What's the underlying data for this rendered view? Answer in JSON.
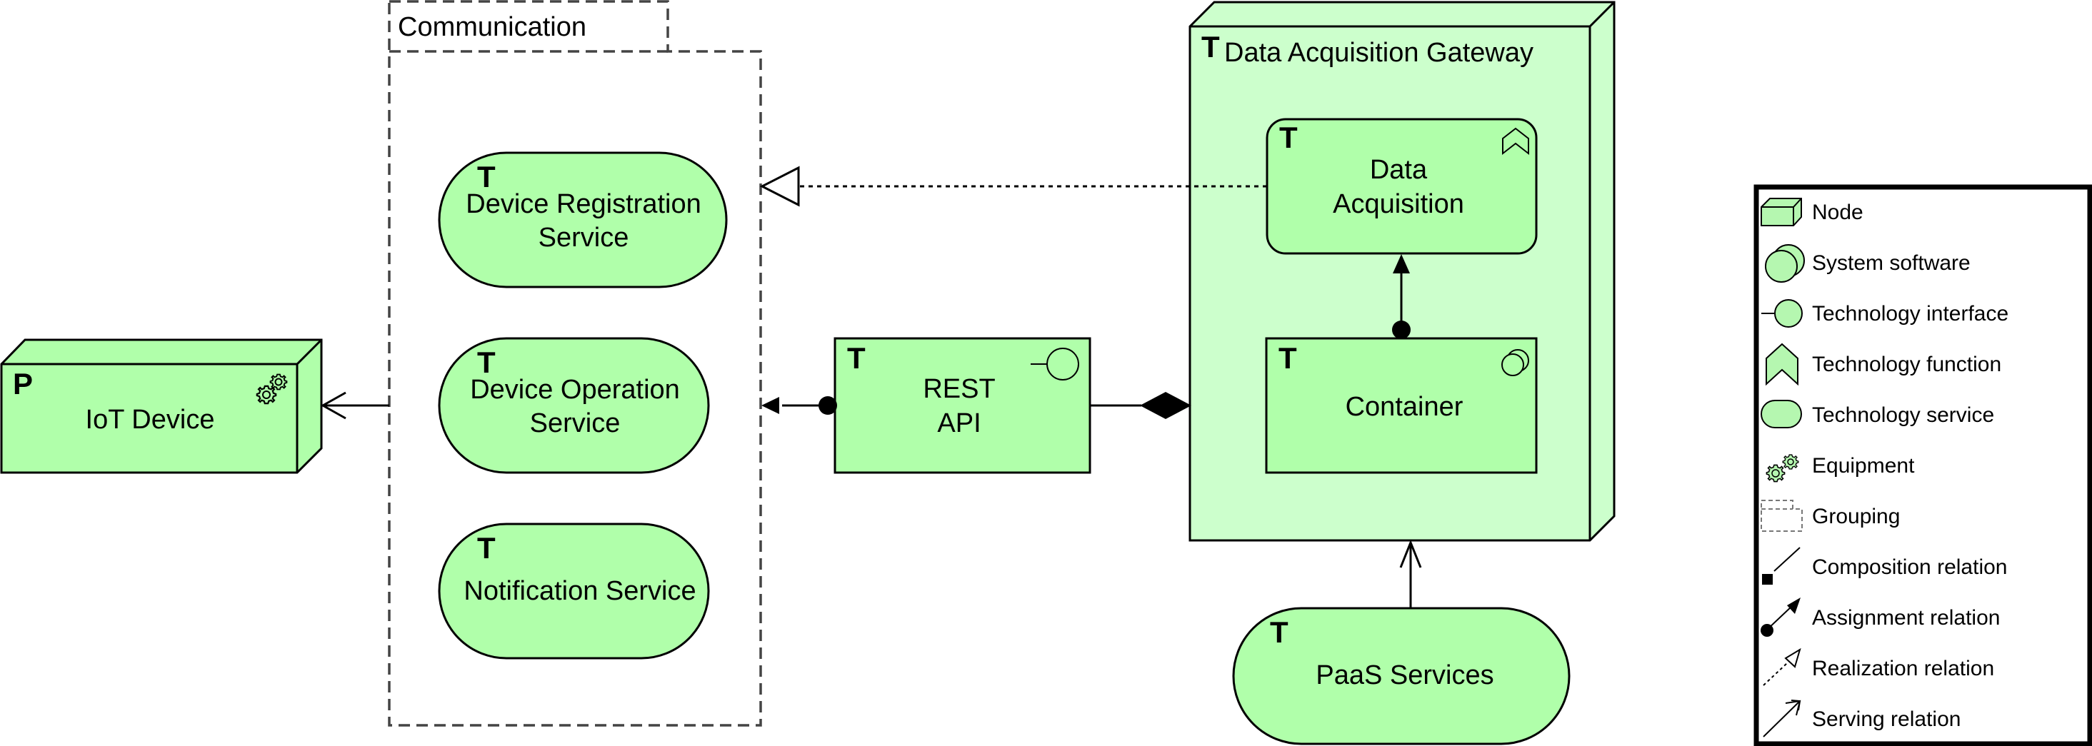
{
  "colors": {
    "element_fill": "#B0FFAA",
    "node_light_fill": "#CCFFCC",
    "stroke": "#000000",
    "grouping_stroke": "#444444",
    "legend_icon_fill": "#B5F7B0"
  },
  "grouping": {
    "label": "Communication"
  },
  "elements": {
    "iot_device": {
      "marker": "P",
      "label": "IoT Device",
      "icon": "equipment-gears-icon"
    },
    "device_registration": {
      "marker": "T",
      "label_line1": "Device Registration",
      "label_line2": "Service"
    },
    "device_operation": {
      "marker": "T",
      "label_line1": "Device Operation",
      "label_line2": "Service"
    },
    "notification": {
      "marker": "T",
      "label": "Notification Service"
    },
    "rest_api": {
      "marker": "T",
      "label_line1": "REST",
      "label_line2": "API",
      "icon": "technology-interface-icon"
    },
    "gateway": {
      "marker": "T",
      "label": "Data Acquisition Gateway"
    },
    "data_acquisition": {
      "marker": "T",
      "label_line1": "Data",
      "label_line2": "Acquisition",
      "icon": "technology-function-icon"
    },
    "container": {
      "marker": "T",
      "label": "Container",
      "icon": "system-software-icon"
    },
    "paas": {
      "marker": "T",
      "label": "PaaS Services"
    }
  },
  "relations": [
    {
      "type": "serving",
      "from": "Communication",
      "to": "IoT Device"
    },
    {
      "type": "realization",
      "from": "Data Acquisition",
      "to": "Communication"
    },
    {
      "type": "assignment",
      "from": "REST API",
      "to": "Device Operation Service"
    },
    {
      "type": "composition",
      "from": "Data Acquisition Gateway",
      "to": "REST API"
    },
    {
      "type": "assignment",
      "from": "Container",
      "to": "Data Acquisition"
    },
    {
      "type": "serving",
      "from": "PaaS Services",
      "to": "Data Acquisition Gateway"
    }
  ],
  "legend": {
    "items": [
      {
        "icon": "node-icon",
        "label": "Node"
      },
      {
        "icon": "system-software-icon",
        "label": "System software"
      },
      {
        "icon": "technology-interface-icon",
        "label": "Technology interface"
      },
      {
        "icon": "technology-function-icon",
        "label": "Technology function"
      },
      {
        "icon": "technology-service-icon",
        "label": "Technology service"
      },
      {
        "icon": "equipment-icon",
        "label": "Equipment"
      },
      {
        "icon": "grouping-icon",
        "label": "Grouping"
      },
      {
        "icon": "composition-relation-icon",
        "label": "Composition relation"
      },
      {
        "icon": "assignment-relation-icon",
        "label": "Assignment relation"
      },
      {
        "icon": "realization-relation-icon",
        "label": "Realization relation"
      },
      {
        "icon": "serving-relation-icon",
        "label": "Serving relation"
      }
    ]
  }
}
